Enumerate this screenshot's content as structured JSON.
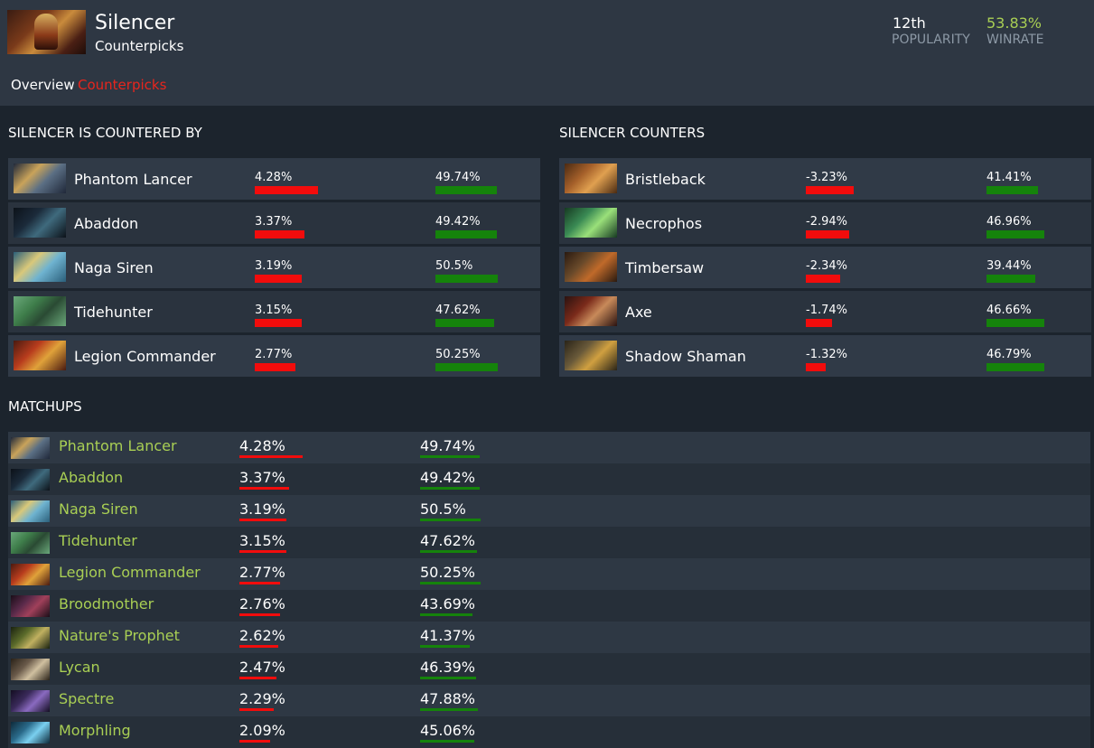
{
  "hero": {
    "name": "Silencer",
    "subtitle": "Counterpicks"
  },
  "stats": {
    "popularity_value": "12th",
    "popularity_label": "POPULARITY",
    "winrate_value": "53.83%",
    "winrate_label": "WINRATE"
  },
  "tabs": {
    "overview": "Overview",
    "counterpicks": "Counterpicks"
  },
  "colors": {
    "advantage_bar": "#f20c0c",
    "winrate_bar": "#15830b",
    "hero_link": "#a9cf54",
    "active_tab": "#e8251d"
  },
  "countered_by": {
    "title": "SILENCER IS COUNTERED BY",
    "rows": [
      {
        "hero": "Phantom Lancer",
        "icon": "phantom-lancer-icon",
        "advantage": "4.28%",
        "advantage_num": 4.28,
        "winrate": "49.74%",
        "winrate_num": 49.74
      },
      {
        "hero": "Abaddon",
        "icon": "abaddon-icon",
        "advantage": "3.37%",
        "advantage_num": 3.37,
        "winrate": "49.42%",
        "winrate_num": 49.42
      },
      {
        "hero": "Naga Siren",
        "icon": "naga-siren-icon",
        "advantage": "3.19%",
        "advantage_num": 3.19,
        "winrate": "50.5%",
        "winrate_num": 50.5
      },
      {
        "hero": "Tidehunter",
        "icon": "tidehunter-icon",
        "advantage": "3.15%",
        "advantage_num": 3.15,
        "winrate": "47.62%",
        "winrate_num": 47.62
      },
      {
        "hero": "Legion Commander",
        "icon": "legion-commander-icon",
        "advantage": "2.77%",
        "advantage_num": 2.77,
        "winrate": "50.25%",
        "winrate_num": 50.25
      }
    ]
  },
  "counters": {
    "title": "SILENCER COUNTERS",
    "rows": [
      {
        "hero": "Bristleback",
        "icon": "bristleback-icon",
        "advantage": "-3.23%",
        "advantage_num": -3.23,
        "winrate": "41.41%",
        "winrate_num": 41.41
      },
      {
        "hero": "Necrophos",
        "icon": "necrophos-icon",
        "advantage": "-2.94%",
        "advantage_num": -2.94,
        "winrate": "46.96%",
        "winrate_num": 46.96
      },
      {
        "hero": "Timbersaw",
        "icon": "timbersaw-icon",
        "advantage": "-2.34%",
        "advantage_num": -2.34,
        "winrate": "39.44%",
        "winrate_num": 39.44
      },
      {
        "hero": "Axe",
        "icon": "axe-icon",
        "advantage": "-1.74%",
        "advantage_num": -1.74,
        "winrate": "46.66%",
        "winrate_num": 46.66
      },
      {
        "hero": "Shadow Shaman",
        "icon": "shadow-shaman-icon",
        "advantage": "-1.32%",
        "advantage_num": -1.32,
        "winrate": "46.79%",
        "winrate_num": 46.79
      }
    ]
  },
  "matchups": {
    "title": "MATCHUPS",
    "rows": [
      {
        "hero": "Phantom Lancer",
        "icon": "phantom-lancer-icon",
        "advantage": "4.28%",
        "advantage_num": 4.28,
        "winrate": "49.74%",
        "winrate_num": 49.74
      },
      {
        "hero": "Abaddon",
        "icon": "abaddon-icon",
        "advantage": "3.37%",
        "advantage_num": 3.37,
        "winrate": "49.42%",
        "winrate_num": 49.42
      },
      {
        "hero": "Naga Siren",
        "icon": "naga-siren-icon",
        "advantage": "3.19%",
        "advantage_num": 3.19,
        "winrate": "50.5%",
        "winrate_num": 50.5
      },
      {
        "hero": "Tidehunter",
        "icon": "tidehunter-icon",
        "advantage": "3.15%",
        "advantage_num": 3.15,
        "winrate": "47.62%",
        "winrate_num": 47.62
      },
      {
        "hero": "Legion Commander",
        "icon": "legion-commander-icon",
        "advantage": "2.77%",
        "advantage_num": 2.77,
        "winrate": "50.25%",
        "winrate_num": 50.25
      },
      {
        "hero": "Broodmother",
        "icon": "broodmother-icon",
        "advantage": "2.76%",
        "advantage_num": 2.76,
        "winrate": "43.69%",
        "winrate_num": 43.69
      },
      {
        "hero": "Nature's Prophet",
        "icon": "natures-prophet-icon",
        "advantage": "2.62%",
        "advantage_num": 2.62,
        "winrate": "41.37%",
        "winrate_num": 41.37
      },
      {
        "hero": "Lycan",
        "icon": "lycan-icon",
        "advantage": "2.47%",
        "advantage_num": 2.47,
        "winrate": "46.39%",
        "winrate_num": 46.39
      },
      {
        "hero": "Spectre",
        "icon": "spectre-icon",
        "advantage": "2.29%",
        "advantage_num": 2.29,
        "winrate": "47.88%",
        "winrate_num": 47.88
      },
      {
        "hero": "Morphling",
        "icon": "morphling-icon",
        "advantage": "2.09%",
        "advantage_num": 2.09,
        "winrate": "45.06%",
        "winrate_num": 45.06
      }
    ]
  }
}
